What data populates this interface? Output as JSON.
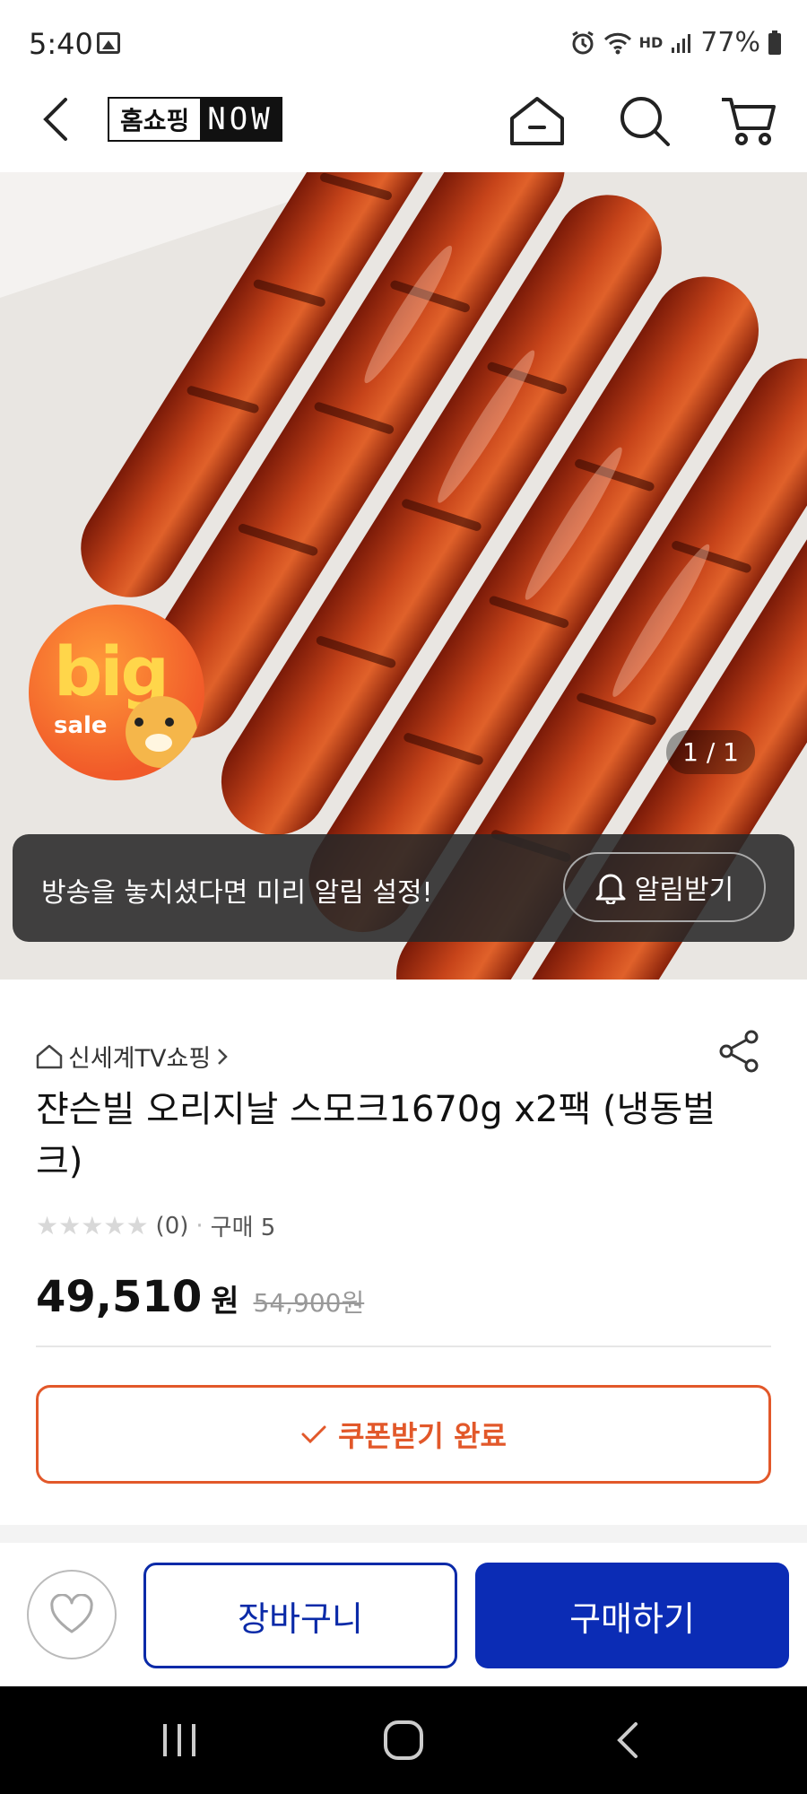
{
  "status_bar": {
    "time": "5:40",
    "battery": "77%",
    "network_label": "HD"
  },
  "topnav": {
    "logo_left": "홈쇼핑",
    "logo_right": "NOW"
  },
  "hero": {
    "badge_big": "big",
    "badge_sale": "sale",
    "page_counter": "1 / 1"
  },
  "alert": {
    "text": "방송을 놓치셨다면 미리 알림 설정!",
    "button": "알림받기"
  },
  "product": {
    "store": "신세계TV쇼핑",
    "title": "쟌슨빌 오리지날 스모크1670g x2팩 (냉동벌크)",
    "rating_count": "(0)",
    "purchase_count": "구매 5",
    "rating_stars": 0,
    "price": "49,510",
    "price_unit": "원",
    "original_price": "54,900원",
    "coupon_label": "쿠폰받기 완료"
  },
  "actions": {
    "cart": "장바구니",
    "buy": "구매하기"
  },
  "colors": {
    "accent_blue": "#0b2cb5",
    "coupon_orange": "#e2582a"
  }
}
